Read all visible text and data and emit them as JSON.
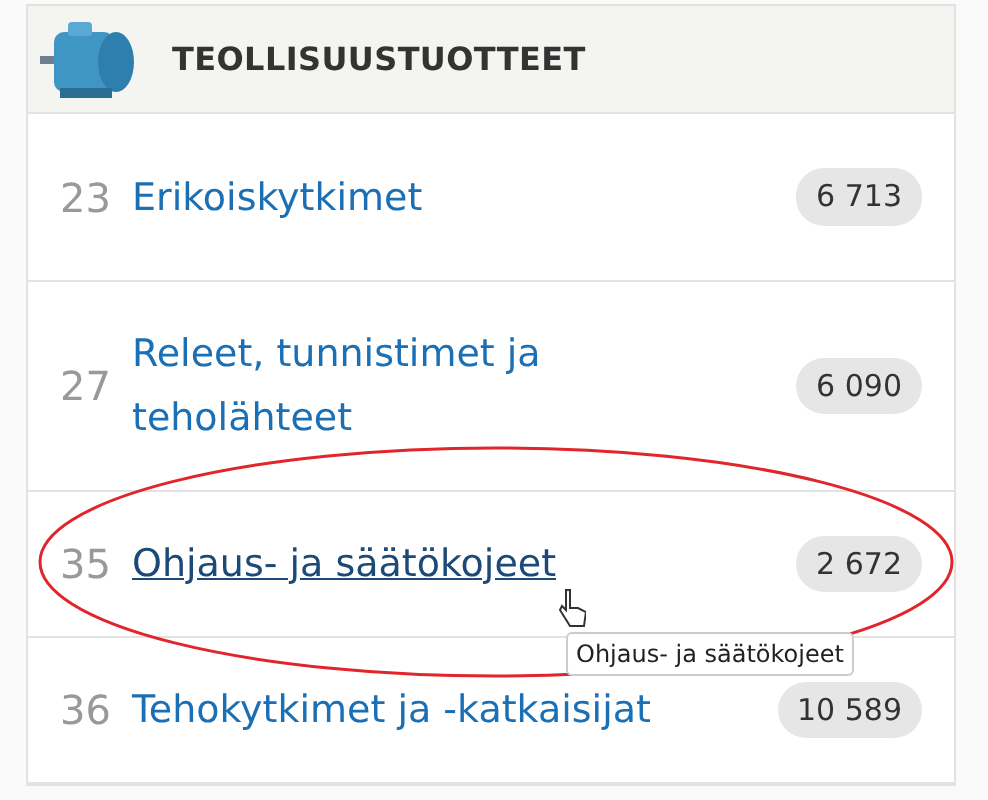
{
  "header": {
    "title": "TEOLLISUUSTUOTTEET"
  },
  "items": [
    {
      "code": "23",
      "name": "Erikoiskytkimet",
      "count": "6 713",
      "hovered": false
    },
    {
      "code": "27",
      "name": "Releet, tunnistimet ja teholähteet",
      "count": "6 090",
      "hovered": false
    },
    {
      "code": "35",
      "name": "Ohjaus- ja säätökojeet",
      "count": "2 672",
      "hovered": true
    },
    {
      "code": "36",
      "name": "Tehokytkimet ja -katkaisijat",
      "count": "10 589",
      "hovered": false
    }
  ],
  "tooltip": {
    "text": "Ohjaus- ja säätökojeet"
  }
}
